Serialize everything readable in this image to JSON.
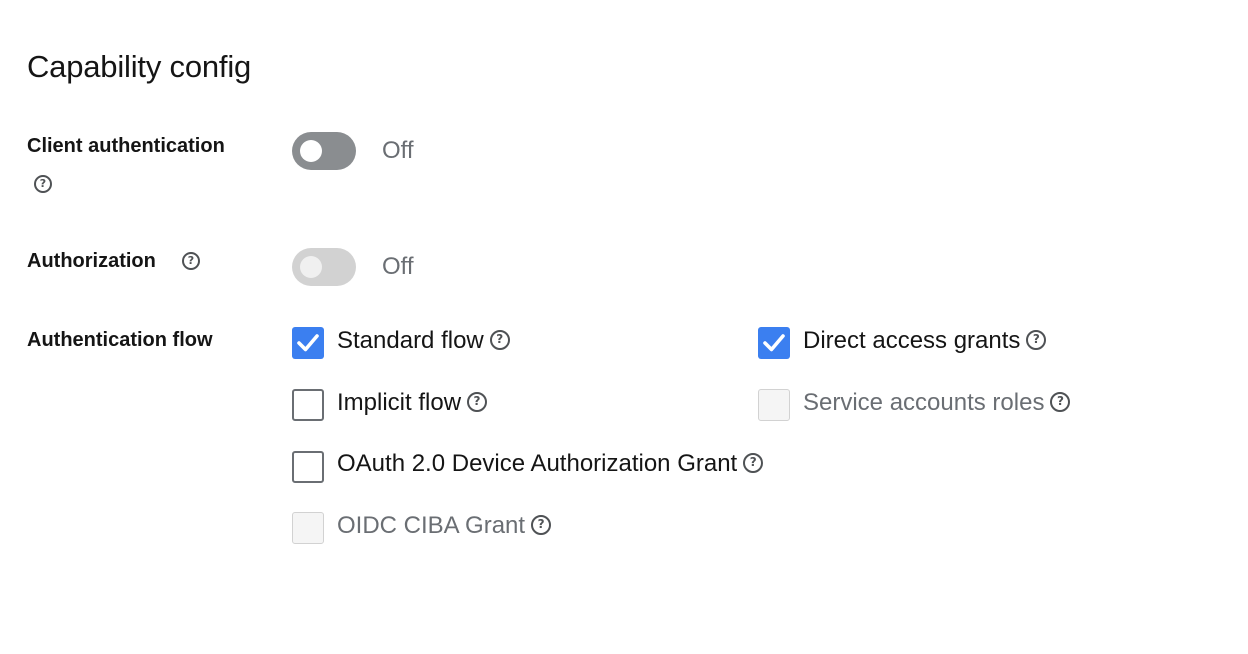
{
  "section": {
    "title": "Capability config"
  },
  "client_authentication": {
    "label": "Client authentication",
    "state_text": "Off",
    "enabled": false
  },
  "authorization": {
    "label": "Authorization",
    "state_text": "Off",
    "enabled": false,
    "disabled": true
  },
  "authentication_flow": {
    "label": "Authentication flow",
    "options": [
      {
        "label": "Standard flow",
        "checked": true,
        "disabled": false
      },
      {
        "label": "Direct access grants",
        "checked": true,
        "disabled": false
      },
      {
        "label": "Implicit flow",
        "checked": false,
        "disabled": false
      },
      {
        "label": "Service accounts roles",
        "checked": false,
        "disabled": true
      },
      {
        "label": "OAuth 2.0 Device Authorization Grant",
        "checked": false,
        "disabled": false
      },
      {
        "label": "OIDC CIBA Grant",
        "checked": false,
        "disabled": true
      }
    ]
  },
  "colors": {
    "checkbox_checked": "#3b7ff0",
    "switch_off": "#8a8d90",
    "switch_disabled": "#d2d2d2",
    "muted_text": "#6a6e73"
  },
  "icons": {
    "help": "question-circle-icon",
    "check": "checkmark-icon"
  }
}
